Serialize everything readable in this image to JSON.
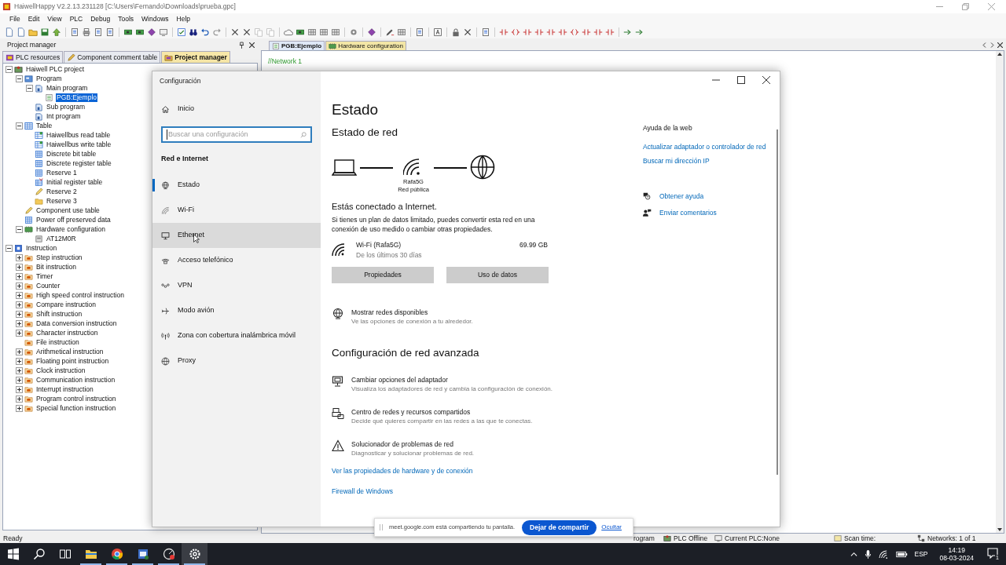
{
  "app": {
    "title": "HaiwellHappy V2.2.13.231128 [C:\\Users\\Fernando\\Downloads\\prueba.gpc]",
    "menu": [
      "File",
      "Edit",
      "View",
      "PLC",
      "Debug",
      "Tools",
      "Windows",
      "Help"
    ]
  },
  "project_panel": {
    "title": "Project manager",
    "tabs": [
      {
        "label": "PLC resources",
        "selected": false
      },
      {
        "label": "Component comment table",
        "selected": false
      },
      {
        "label": "Project manager",
        "selected": true
      }
    ],
    "tree": [
      {
        "label": "Haiwell PLC project",
        "kind": "project",
        "expanded": true,
        "selected": false,
        "children": [
          {
            "label": "Program",
            "kind": "program-group",
            "expanded": true,
            "selected": false,
            "children": [
              {
                "label": "Main program",
                "kind": "program",
                "expanded": true,
                "selected": false,
                "children": [
                  {
                    "label": "PGB:Ejemplo",
                    "kind": "ladder",
                    "selected": true
                  }
                ]
              },
              {
                "label": "Sub program",
                "kind": "program",
                "selected": false
              },
              {
                "label": "Int program",
                "kind": "program",
                "selected": false
              }
            ]
          },
          {
            "label": "Table",
            "kind": "table",
            "expanded": true,
            "selected": false,
            "children": [
              {
                "label": "Haiwellbus read table",
                "kind": "comm-table",
                "selected": false
              },
              {
                "label": "Haiwellbus write table",
                "kind": "comm-table",
                "selected": false
              },
              {
                "label": "Discrete bit table",
                "kind": "sheet",
                "selected": false
              },
              {
                "label": "Discrete register table",
                "kind": "sheet",
                "selected": false
              },
              {
                "label": "Reserve 1",
                "kind": "sheet",
                "selected": false
              },
              {
                "label": "Initial register table",
                "kind": "sheet-red",
                "selected": false
              },
              {
                "label": "Reserve 2",
                "kind": "pencil",
                "selected": false
              },
              {
                "label": "Reserve 3",
                "kind": "folder",
                "selected": false
              }
            ]
          },
          {
            "label": "Component use table",
            "kind": "pencil",
            "selected": false
          },
          {
            "label": "Power off preserved data",
            "kind": "sheet",
            "selected": false
          },
          {
            "label": "Hardware configuration",
            "kind": "hardware",
            "expanded": true,
            "selected": false,
            "children": [
              {
                "label": "AT12M0R",
                "kind": "device",
                "selected": false
              }
            ]
          }
        ]
      },
      {
        "label": "Instruction",
        "kind": "instruction",
        "expanded": true,
        "selected": false,
        "children": [
          {
            "label": "Step instruction",
            "kind": "category",
            "expanded": false,
            "selected": false
          },
          {
            "label": "Bit instruction",
            "kind": "category",
            "expanded": false,
            "selected": false
          },
          {
            "label": "Timer",
            "kind": "category",
            "expanded": false,
            "selected": false
          },
          {
            "label": "Counter",
            "kind": "category",
            "expanded": false,
            "selected": false
          },
          {
            "label": "High speed control instruction",
            "kind": "category",
            "expanded": false,
            "selected": false
          },
          {
            "label": "Compare instruction",
            "kind": "category",
            "expanded": false,
            "selected": false
          },
          {
            "label": "Shift instruction",
            "kind": "category",
            "expanded": false,
            "selected": false
          },
          {
            "label": "Data conversion instruction",
            "kind": "category",
            "expanded": false,
            "selected": false
          },
          {
            "label": "Character instruction",
            "kind": "category",
            "expanded": false,
            "selected": false
          },
          {
            "label": "File instruction",
            "kind": "category",
            "selected": false
          },
          {
            "label": "Arithmetical instruction",
            "kind": "category",
            "expanded": false,
            "selected": false
          },
          {
            "label": "Floating point instruction",
            "kind": "category",
            "expanded": false,
            "selected": false
          },
          {
            "label": "Clock instruction",
            "kind": "category",
            "expanded": false,
            "selected": false
          },
          {
            "label": "Communication instruction",
            "kind": "category",
            "expanded": false,
            "selected": false
          },
          {
            "label": "Interrupt instruction",
            "kind": "category",
            "expanded": false,
            "selected": false
          },
          {
            "label": "Program control instruction",
            "kind": "category",
            "expanded": false,
            "selected": false
          },
          {
            "label": "Special function instruction",
            "kind": "category",
            "expanded": false,
            "selected": false
          }
        ]
      }
    ]
  },
  "editor": {
    "tabs": [
      {
        "label": "PGB:Ejemplo",
        "selected": true
      },
      {
        "label": "Hardware configuration",
        "selected": false
      }
    ],
    "lines": [
      "//Network 1"
    ]
  },
  "status_bar": [
    {
      "label": "Ready"
    },
    {
      "label": "rogram"
    },
    {
      "label": "PLC Offline"
    },
    {
      "label": "Current PLC:None"
    },
    {
      "label": "Scan time:"
    },
    {
      "label": "Networks:  1 of 1"
    }
  ],
  "settings": {
    "title": "Configuración",
    "home": "Inicio",
    "search_placeholder": "Buscar una configuración",
    "section": "Red e Internet",
    "nav": [
      {
        "label": "Estado",
        "kind": "status",
        "selected": true,
        "hovered": false
      },
      {
        "label": "Wi-Fi",
        "kind": "wifi",
        "selected": false,
        "hovered": false
      },
      {
        "label": "Ethernet",
        "kind": "ethernet",
        "selected": false,
        "hovered": true
      },
      {
        "label": "Acceso telefónico",
        "kind": "dialup",
        "selected": false,
        "hovered": false
      },
      {
        "label": "VPN",
        "kind": "vpn",
        "selected": false,
        "hovered": false
      },
      {
        "label": "Modo avión",
        "kind": "airplane",
        "selected": false,
        "hovered": false
      },
      {
        "label": "Zona con cobertura inalámbrica móvil",
        "kind": "hotspot",
        "selected": false,
        "hovered": false
      },
      {
        "label": "Proxy",
        "kind": "proxy",
        "selected": false,
        "hovered": false
      }
    ],
    "page": {
      "title": "Estado",
      "subtitle": "Estado de red",
      "network_name": "Rafa5G",
      "network_type": "Red pública",
      "connection_title": "Estás conectado a Internet.",
      "connection_text": "Si tienes un plan de datos limitado, puedes convertir esta red en una conexión de uso medido o cambiar otras propiedades.",
      "usage": {
        "name": "Wi-Fi (Rafa5G)",
        "period": "De los últimos 30 días",
        "amount": "69.99 GB"
      },
      "buttons": [
        "Propiedades",
        "Uso de datos"
      ],
      "show_networks": {
        "title": "Mostrar redes disponibles",
        "description": "Ve las opciones de conexión a tu alrededor."
      },
      "advanced_title": "Configuración de red avanzada",
      "advanced": [
        {
          "kind": "adapter",
          "title": "Cambiar opciones del adaptador",
          "description": "Visualiza los adaptadores de red y cambia la configuración de conexión."
        },
        {
          "kind": "sharing",
          "title": "Centro de redes y recursos compartidos",
          "description": "Decide qué quieres compartir en las redes a las que te conectas."
        },
        {
          "kind": "troubleshoot",
          "title": "Solucionador de problemas de red",
          "description": "Diagnosticar y solucionar problemas de red."
        }
      ],
      "links": [
        "Ver las propiedades de hardware y de conexión",
        "Firewall de Windows"
      ]
    },
    "aside": {
      "title": "Ayuda de la web",
      "links": [
        "Actualizar adaptador o controlador de red",
        "Buscar mi dirección IP"
      ],
      "support": [
        {
          "kind": "help",
          "label": "Obtener ayuda"
        },
        {
          "kind": "feedback",
          "label": "Enviar comentarios"
        }
      ]
    }
  },
  "share_bar": {
    "message": "meet.google.com está compartiendo tu pantalla.",
    "stop": "Dejar de compartir",
    "hide": "Ocultar"
  },
  "taskbar": {
    "apps": [
      {
        "kind": "start",
        "running": false,
        "active": false
      },
      {
        "kind": "search",
        "running": false,
        "active": false
      },
      {
        "kind": "taskview",
        "running": false,
        "active": false
      },
      {
        "kind": "explorer",
        "running": true,
        "active": false
      },
      {
        "kind": "browser",
        "running": true,
        "active": false
      },
      {
        "kind": "plc",
        "running": true,
        "active": false
      },
      {
        "kind": "recorder",
        "running": true,
        "active": false
      },
      {
        "kind": "settings",
        "running": true,
        "active": true
      }
    ],
    "language": "ESP",
    "time": "14:19",
    "date": "08-03-2024",
    "notifications": "1"
  }
}
